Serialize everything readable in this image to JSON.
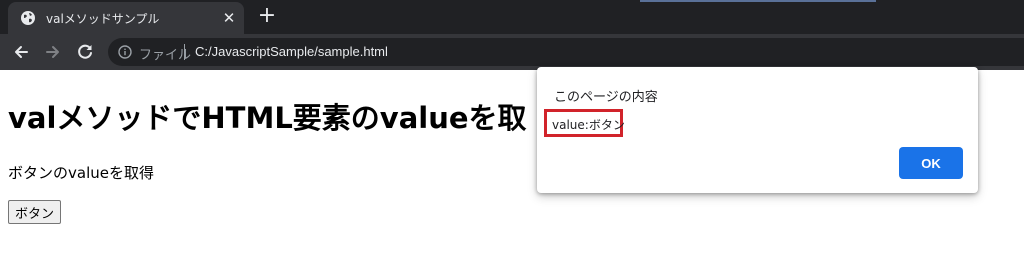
{
  "browser": {
    "tab": {
      "title": "valメソッドサンプル",
      "close": "✕"
    },
    "new_tab": "+",
    "security_label": "ファイル",
    "url": "C:/JavascriptSample/sample.html"
  },
  "page": {
    "heading": "valメソッドでHTML要素のvalueを取",
    "description": "ボタンのvalueを取得",
    "button_label": "ボタン"
  },
  "dialog": {
    "title": "このページの内容",
    "message": "value:ボタン",
    "ok_label": "OK"
  },
  "colors": {
    "chrome_dark": "#202124",
    "toolbar": "#35363a",
    "ok_blue": "#1a73e8",
    "highlight_red": "#d1232a"
  },
  "icons": [
    "globe-icon",
    "close-icon",
    "plus-icon",
    "back-arrow-icon",
    "forward-arrow-icon",
    "reload-icon",
    "info-icon"
  ]
}
